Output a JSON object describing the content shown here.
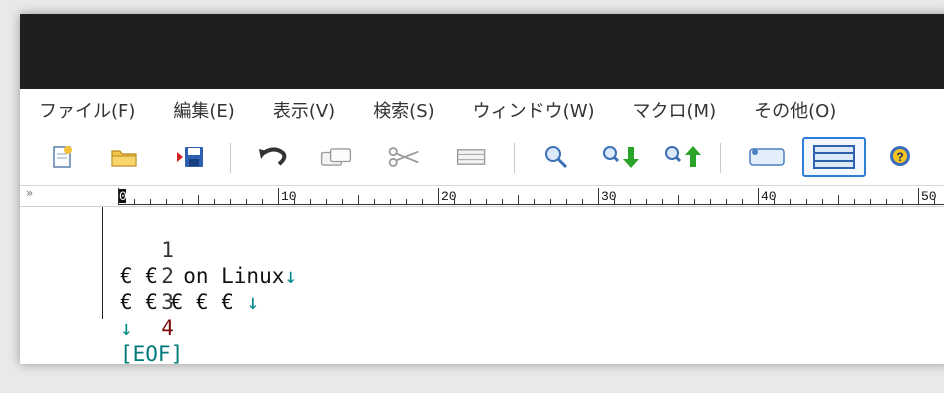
{
  "menu": {
    "items": [
      "ファイル(F)",
      "編集(E)",
      "表示(V)",
      "検索(S)",
      "ウィンドウ(W)",
      "マクロ(M)",
      "その他(O)"
    ]
  },
  "toolbar": {
    "buttons": [
      "new-file-icon",
      "open-folder-icon",
      "save-icon",
      "undo-icon",
      "copy-icon",
      "cut-icon",
      "paste-icon",
      "search-icon",
      "search-next-icon",
      "search-prev-icon",
      "tag-jump-icon",
      "toggle-view-icon",
      "help-icon"
    ]
  },
  "ruler": {
    "marker": "»",
    "labels": [
      "0",
      "10",
      "20",
      "30",
      "40",
      "50"
    ]
  },
  "editor": {
    "lines": [
      {
        "num": "1",
        "text": "€ €  on Linux",
        "eol": "↓"
      },
      {
        "num": "2",
        "text": "€ € € € € ",
        "eol": "↓"
      },
      {
        "num": "3",
        "text": "",
        "eol": "↓"
      },
      {
        "num": "4",
        "text": "",
        "eol": "[EOF]"
      }
    ]
  },
  "colors": {
    "titlebar": "#1f1f1f",
    "line_number_current": "#7a0a0a",
    "eol_mark": "#008a8a",
    "ruler_accent": "#2e7dd7"
  }
}
